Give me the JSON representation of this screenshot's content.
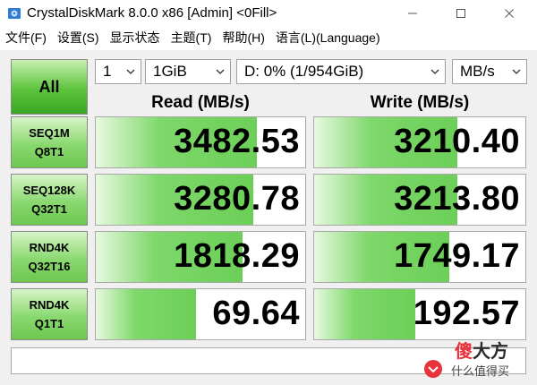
{
  "window": {
    "title": "CrystalDiskMark 8.0.0 x86 [Admin] <0Fill>"
  },
  "menu": {
    "items": [
      "文件(F)",
      "设置(S)",
      "显示状态",
      "主题(T)",
      "帮助(H)",
      "语言(L)(Language)"
    ]
  },
  "controls": {
    "all_label": "All",
    "count": "1",
    "size": "1GiB",
    "drive": "D: 0% (1/954GiB)",
    "unit": "MB/s"
  },
  "headers": {
    "read": "Read (MB/s)",
    "write": "Write (MB/s)"
  },
  "tests": [
    {
      "line1": "SEQ1M",
      "line2": "Q8T1",
      "read": "3482.53",
      "write": "3210.40",
      "read_fill": 0.77,
      "write_fill": 0.68
    },
    {
      "line1": "SEQ128K",
      "line2": "Q32T1",
      "read": "3280.78",
      "write": "3213.80",
      "read_fill": 0.75,
      "write_fill": 0.68
    },
    {
      "line1": "RND4K",
      "line2": "Q32T16",
      "read": "1818.29",
      "write": "1749.17",
      "read_fill": 0.7,
      "write_fill": 0.64
    },
    {
      "line1": "RND4K",
      "line2": "Q1T1",
      "read": "69.64",
      "write": "192.57",
      "read_fill": 0.48,
      "write_fill": 0.48
    }
  ],
  "watermark": {
    "logo_a": "傻",
    "logo_b": "大方",
    "subtitle": "什么值得买"
  },
  "colors": {
    "accent_green": "#5cc43c",
    "bar_green": "#7ed86a"
  }
}
